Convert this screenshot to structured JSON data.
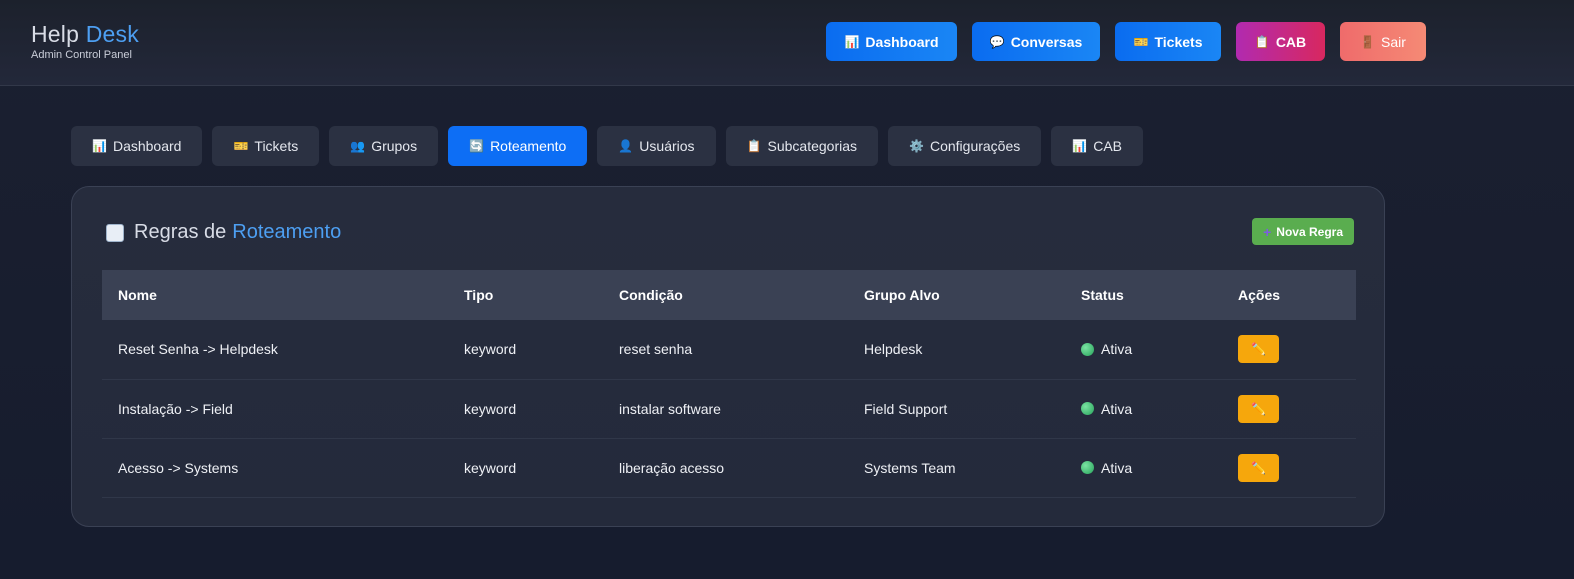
{
  "brand": {
    "title_main": "Help",
    "title_accent": "Desk",
    "subtitle": "Admin Control Panel"
  },
  "top_nav": [
    {
      "label": "Dashboard",
      "icon": "📊",
      "color": "#0a6cf0"
    },
    {
      "label": "Conversas",
      "icon": "💬",
      "color": "#0a6cf0"
    },
    {
      "label": "Tickets",
      "icon": "🎫",
      "color": "#0a6cf0"
    },
    {
      "label": "CAB",
      "icon": "📋",
      "color": "#c8287a"
    },
    {
      "label": "Sair",
      "icon": "🚪",
      "color": "#f07a6f"
    }
  ],
  "tabs": [
    {
      "label": "Dashboard",
      "icon": "📊"
    },
    {
      "label": "Tickets",
      "icon": "🎫"
    },
    {
      "label": "Grupos",
      "icon": "👥"
    },
    {
      "label": "Roteamento",
      "icon": "🔄",
      "active": true
    },
    {
      "label": "Usuários",
      "icon": "👤"
    },
    {
      "label": "Subcategorias",
      "icon": "📋"
    },
    {
      "label": "Configurações",
      "icon": "⚙️"
    },
    {
      "label": "CAB",
      "icon": "📊"
    }
  ],
  "panel": {
    "title_main": "Regras de",
    "title_accent": "Roteamento",
    "new_rule_label": "Nova Regra",
    "new_rule_icon": "+"
  },
  "table": {
    "headers": [
      "Nome",
      "Tipo",
      "Condição",
      "Grupo Alvo",
      "Status",
      "Ações"
    ],
    "rows": [
      {
        "nome": "Reset Senha -> Helpdesk",
        "tipo": "keyword",
        "condicao": "reset senha",
        "grupo": "Helpdesk",
        "status": "Ativa"
      },
      {
        "nome": "Instalação -> Field",
        "tipo": "keyword",
        "condicao": "instalar software",
        "grupo": "Field Support",
        "status": "Ativa"
      },
      {
        "nome": "Acesso -> Systems",
        "tipo": "keyword",
        "condicao": "liberação acesso",
        "grupo": "Systems Team",
        "status": "Ativa"
      }
    ],
    "edit_icon": "✏️"
  }
}
